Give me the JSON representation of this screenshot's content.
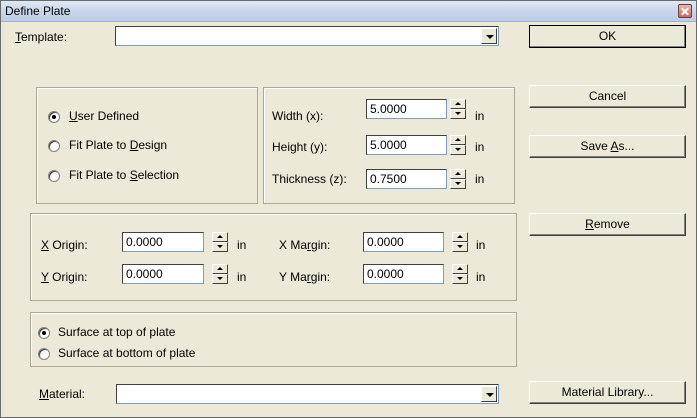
{
  "window": {
    "title": "Define Plate"
  },
  "template": {
    "label": "Template:",
    "value": ""
  },
  "material": {
    "label": "Material:",
    "value": ""
  },
  "buttons": {
    "ok": "OK",
    "cancel": "Cancel",
    "save_as": "Save As...",
    "remove": "Remove",
    "material_library": "Material Library..."
  },
  "plate_source": {
    "options": [
      {
        "label": "User Defined",
        "checked": true
      },
      {
        "label": "Fit Plate to Design",
        "checked": false
      },
      {
        "label": "Fit Plate to Selection",
        "checked": false
      }
    ]
  },
  "dimensions": {
    "width": {
      "label": "Width (x):",
      "value": "5.0000",
      "unit": "in"
    },
    "height": {
      "label": "Height (y):",
      "value": "5.0000",
      "unit": "in"
    },
    "thickness": {
      "label": "Thickness (z):",
      "value": "0.7500",
      "unit": "in"
    }
  },
  "origin": {
    "x_origin": {
      "label": "X Origin:",
      "value": "0.0000",
      "unit": "in"
    },
    "y_origin": {
      "label": "Y Origin:",
      "value": "0.0000",
      "unit": "in"
    },
    "x_margin": {
      "label": "X Margin:",
      "value": "0.0000",
      "unit": "in"
    },
    "y_margin": {
      "label": "Y Margin:",
      "value": "0.0000",
      "unit": "in"
    }
  },
  "surface": {
    "options": [
      {
        "label": "Surface at top of plate",
        "checked": true
      },
      {
        "label": "Surface at bottom of plate",
        "checked": false
      }
    ]
  }
}
